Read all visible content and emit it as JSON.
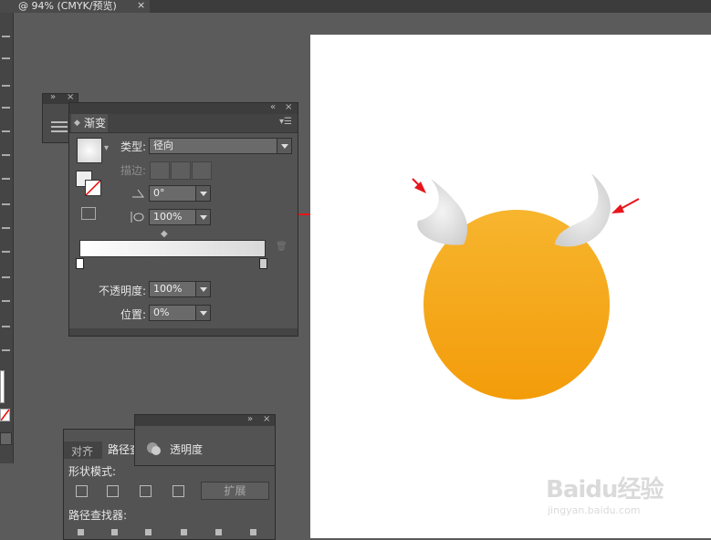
{
  "document_tab": {
    "title": "@ 94% (CMYK/预览)",
    "close": "×"
  },
  "gradient_panel": {
    "tab_label": "渐变",
    "type_label": "类型:",
    "type_value": "径向",
    "stroke_label": "描边:",
    "angle_value": "0°",
    "aspect_value": "100%",
    "opacity_label": "不透明度:",
    "opacity_value": "100%",
    "location_label": "位置:",
    "location_value": "0%"
  },
  "pathfinder_panel": {
    "tab_align": "对齐",
    "tab_pathfinder": "路径查",
    "shape_modes_label": "形状模式:",
    "expand_button": "扩展",
    "pathfinders_label": "路径查找器:"
  },
  "transparency_panel": {
    "tab_label": "透明度"
  },
  "watermark": {
    "brand": "Baidu经验",
    "url": "jingyan.baidu.com"
  },
  "colors": {
    "face_top": "#f6b22e",
    "face_bottom": "#f39c0b",
    "horn": "#e2e2e2",
    "arrow": "#e8141b",
    "ui_bg": "#5b5b5b",
    "panel": "#535353"
  }
}
